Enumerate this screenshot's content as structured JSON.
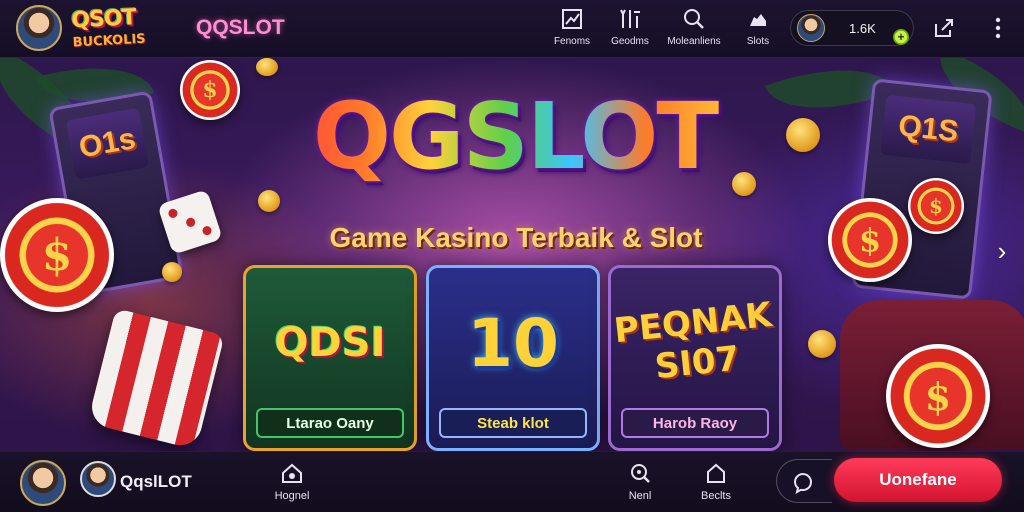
{
  "header": {
    "logo_text": "QSOT",
    "logo_sub": "BUCKOLIS",
    "brand_name": "QQSLOT",
    "nav": [
      {
        "label": "Fenoms",
        "icon": "chart-icon"
      },
      {
        "label": "Geodms",
        "icon": "tools-icon"
      },
      {
        "label": "Moleanliens",
        "icon": "search-icon"
      },
      {
        "label": "Slots",
        "icon": "cloud-icon"
      }
    ],
    "wallet_amount": "1.6K",
    "wallet_add_symbol": "+"
  },
  "hero": {
    "title": "QGSLOT",
    "subtitle": "Game Kasino Terbaik & Slot"
  },
  "scene": {
    "left_machine_text": "O1s",
    "right_machine_text": "Q1S",
    "chip_symbol": "$"
  },
  "games": [
    {
      "art": "QDSI",
      "button": "Ltarao Oany"
    },
    {
      "art": "10",
      "button": "Steab klot"
    },
    {
      "art": "PEQNAK SI07",
      "button": "Harob Raoy"
    }
  ],
  "bottom": {
    "user_name": "QqslLOT",
    "nav": [
      {
        "label": "Hognel",
        "icon": "home-icon"
      },
      {
        "label": "Nenl",
        "icon": "chat-search-icon"
      },
      {
        "label": "Beclts",
        "icon": "house-outline-icon"
      }
    ],
    "cta_label": "Uonefane"
  },
  "colors": {
    "accent": "#ff3b5a",
    "brand_pink": "#ff8fd0",
    "gold": "#ffd36a"
  }
}
